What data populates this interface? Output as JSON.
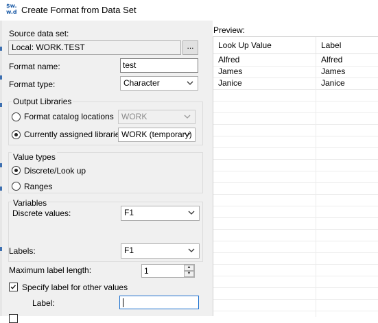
{
  "window": {
    "title": "Create Format from Data Set",
    "icon": "sas-icon"
  },
  "source": {
    "label": "Source data set:",
    "value": "Local: WORK.TEST",
    "browse_label": "..."
  },
  "format_name": {
    "label": "Format name:",
    "value": "test"
  },
  "format_type": {
    "label": "Format type:",
    "value": "Character"
  },
  "output_libraries": {
    "title": "Output Libraries",
    "catalog_option": "Format catalog locations",
    "catalog_value": "WORK",
    "assigned_option": "Currently assigned libraries",
    "assigned_value": "WORK (temporary)",
    "selected": "assigned"
  },
  "value_types": {
    "title": "Value types",
    "discrete": "Discrete/Look up",
    "ranges": "Ranges",
    "selected": "discrete"
  },
  "variables": {
    "title": "Variables",
    "discrete_label": "Discrete values:",
    "discrete_value": "F1",
    "labels_label": "Labels:",
    "labels_value": "F1"
  },
  "max_label": {
    "label": "Maximum label length:",
    "value": "1"
  },
  "other": {
    "checkbox_label": "Specify label for other values",
    "checked": true,
    "label_label": "Label:",
    "label_value": ""
  },
  "preview": {
    "title": "Preview:",
    "columns": [
      "Look Up Value",
      "Label"
    ],
    "rows": [
      [
        "Alfred",
        "Alfred"
      ],
      [
        "James",
        "James"
      ],
      [
        "Janice",
        "Janice"
      ]
    ]
  }
}
